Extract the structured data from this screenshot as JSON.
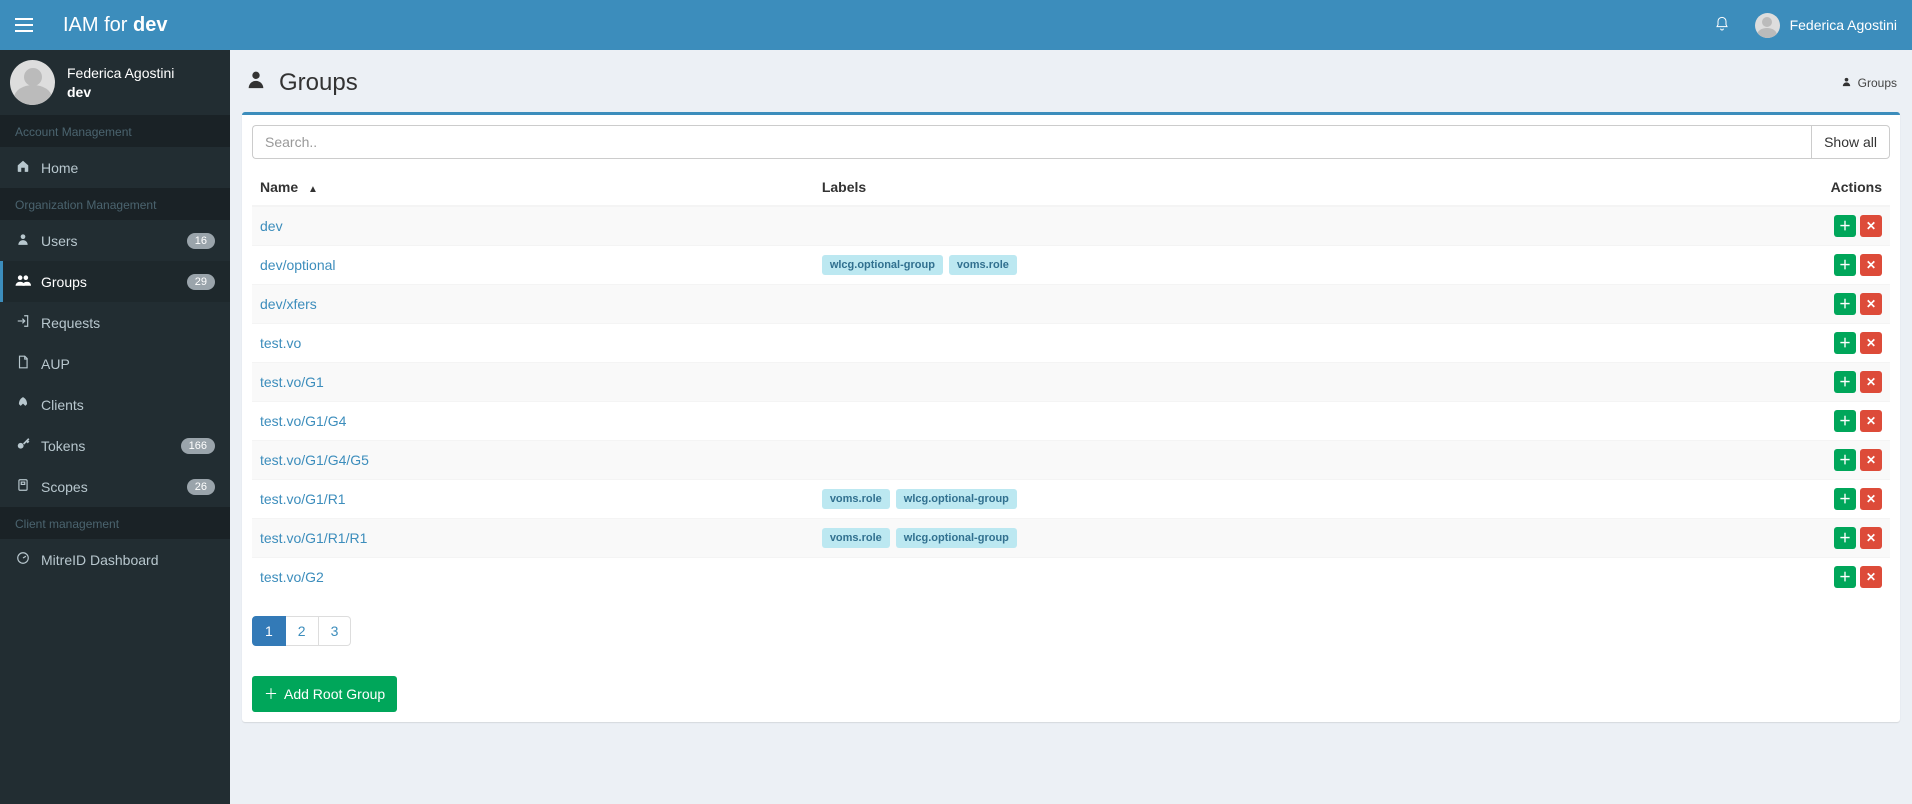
{
  "header": {
    "brand_prefix": "IAM for ",
    "brand_bold": "dev",
    "user_name": "Federica Agostini"
  },
  "sidebar": {
    "user": {
      "name": "Federica Agostini",
      "org": "dev"
    },
    "sections": [
      {
        "header": "Account Management",
        "items": [
          {
            "icon": "home",
            "label": "Home",
            "badge": null,
            "key": "home"
          }
        ]
      },
      {
        "header": "Organization Management",
        "items": [
          {
            "icon": "user",
            "label": "Users",
            "badge": "16",
            "key": "users"
          },
          {
            "icon": "users",
            "label": "Groups",
            "badge": "29",
            "key": "groups",
            "active": true
          },
          {
            "icon": "signin",
            "label": "Requests",
            "badge": null,
            "key": "requests"
          },
          {
            "icon": "doc",
            "label": "AUP",
            "badge": null,
            "key": "aup"
          },
          {
            "icon": "rocket",
            "label": "Clients",
            "badge": null,
            "key": "clients"
          },
          {
            "icon": "key",
            "label": "Tokens",
            "badge": "166",
            "key": "tokens"
          },
          {
            "icon": "tag",
            "label": "Scopes",
            "badge": "26",
            "key": "scopes"
          }
        ]
      },
      {
        "header": "Client management",
        "items": [
          {
            "icon": "dash",
            "label": "MitreID Dashboard",
            "badge": null,
            "key": "mitreid"
          }
        ]
      }
    ]
  },
  "page": {
    "title": "Groups",
    "breadcrumb": "Groups",
    "search_placeholder": "Search..",
    "show_all_label": "Show all",
    "columns": {
      "name": "Name",
      "labels": "Labels",
      "actions": "Actions"
    },
    "add_root_label": "Add Root Group",
    "pagination": {
      "pages": [
        "1",
        "2",
        "3"
      ],
      "active": "1"
    },
    "rows": [
      {
        "name": "dev",
        "labels": []
      },
      {
        "name": "dev/optional",
        "labels": [
          "wlcg.optional-group",
          "voms.role"
        ]
      },
      {
        "name": "dev/xfers",
        "labels": []
      },
      {
        "name": "test.vo",
        "labels": []
      },
      {
        "name": "test.vo/G1",
        "labels": []
      },
      {
        "name": "test.vo/G1/G4",
        "labels": []
      },
      {
        "name": "test.vo/G1/G4/G5",
        "labels": []
      },
      {
        "name": "test.vo/G1/R1",
        "labels": [
          "voms.role",
          "wlcg.optional-group"
        ]
      },
      {
        "name": "test.vo/G1/R1/R1",
        "labels": [
          "voms.role",
          "wlcg.optional-group"
        ]
      },
      {
        "name": "test.vo/G2",
        "labels": []
      }
    ]
  }
}
